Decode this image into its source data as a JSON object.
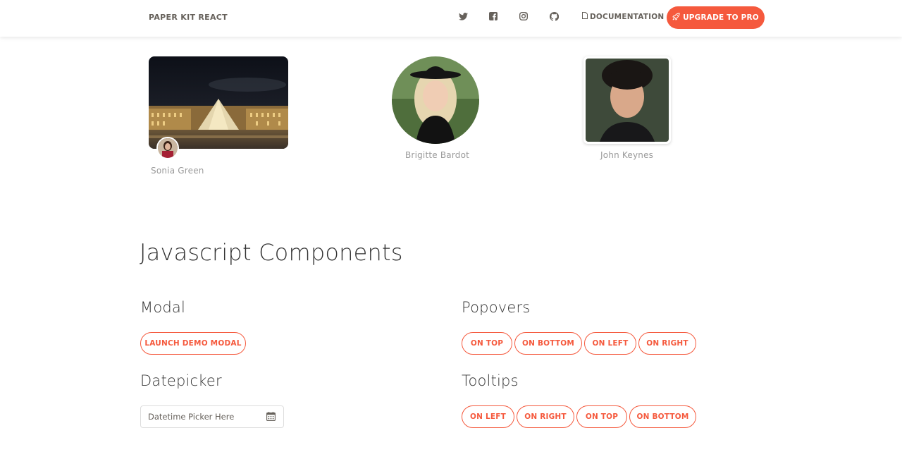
{
  "navbar": {
    "brand": "PAPER KIT REACT",
    "icons": [
      "twitter-icon",
      "facebook-icon",
      "instagram-icon",
      "github-icon"
    ],
    "documentation_label": "DOCUMENTATION",
    "upgrade_label": "UPGRADE TO PRO"
  },
  "images": {
    "rounded_caption": "Sonia Green",
    "circle_caption": "Brigitte Bardot",
    "thumbnail_caption": "John Keynes"
  },
  "section": {
    "title": "Javascript Components",
    "modal": {
      "title": "Modal",
      "button": "LAUNCH DEMO MODAL"
    },
    "popovers": {
      "title": "Popovers",
      "buttons": [
        "ON TOP",
        "ON BOTTOM",
        "ON LEFT",
        "ON RIGHT"
      ]
    },
    "datepicker": {
      "title": "Datepicker",
      "placeholder": "Datetime Picker Here"
    },
    "tooltips": {
      "title": "Tooltips",
      "buttons": [
        "ON LEFT",
        "ON RIGHT",
        "ON TOP",
        "ON BOTTOM"
      ]
    }
  },
  "colors": {
    "accent": "#f5593d",
    "text": "#333333",
    "muted": "#9a9a9a"
  }
}
